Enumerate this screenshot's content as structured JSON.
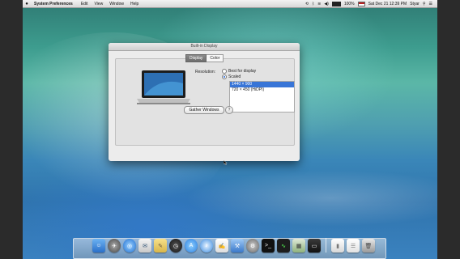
{
  "menubar": {
    "apple": "",
    "app_name": "System Preferences",
    "menus": [
      "Edit",
      "View",
      "Window",
      "Help"
    ],
    "battery_percent": "100%",
    "datetime": "Sat Dec 21  12:39 PM",
    "user": "Styar"
  },
  "window": {
    "title": "Built-in Display",
    "tabs": [
      "Display",
      "Color"
    ],
    "resolution_label": "Resolution:",
    "options": [
      "Best for display",
      "Scaled"
    ],
    "scaled_list": [
      "1440 × 900",
      "720 × 450 (HiDPI)"
    ],
    "gather_button": "Gather Windows",
    "help_button": "?"
  },
  "colors": {
    "selection": "#3875d7",
    "tab_active": "#6e6e6e"
  },
  "dock": {
    "icons": [
      "finder-icon",
      "launchpad-icon",
      "safari-icon",
      "mail-icon",
      "notes-icon",
      "dashboard-icon",
      "appstore-icon",
      "itunes-icon",
      "textedit-icon",
      "xcode-icon",
      "system-preferences-icon",
      "terminal-icon",
      "activity-monitor-icon",
      "preview-icon",
      "app-icon",
      "folder-icon",
      "document-icon",
      "trash-icon"
    ]
  }
}
